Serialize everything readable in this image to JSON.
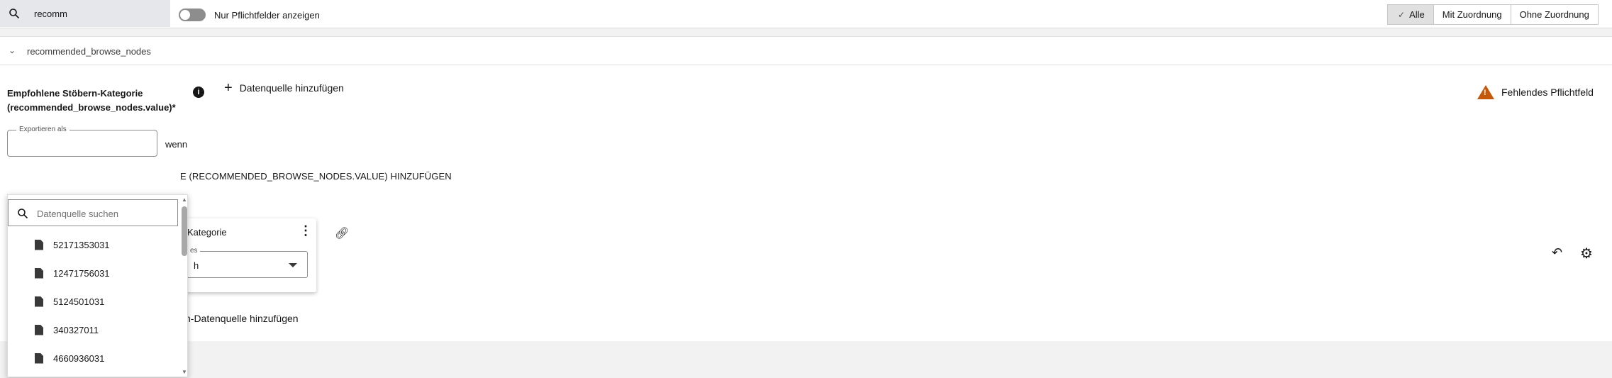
{
  "topbar": {
    "search_value": "recomm",
    "toggle_label": "Nur Pflichtfelder anzeigen",
    "filters": [
      "Alle",
      "Mit Zuordnung",
      "Ohne Zuordnung"
    ],
    "active_filter": "Alle"
  },
  "section": {
    "title": "recommended_browse_nodes"
  },
  "field": {
    "label": "Empfohlene Stöbern-Kategorie (recommended_browse_nodes.value)*",
    "add_source": "Datenquelle hinzufügen",
    "warning": "Fehlendes Pflichtfeld",
    "export_label": "Exportieren als",
    "wenn": "wenn",
    "rule_text": "E (RECOMMENDED_BROWSE_NODES.VALUE) HINZUFÜGEN",
    "card_title": "Kategorie",
    "card_select_label": "es",
    "card_select_value": "h",
    "bottom_add": "ch-Datenquelle hinzufügen"
  },
  "dropdown": {
    "search_placeholder": "Datenquelle suchen",
    "items": [
      "52171353031",
      "12471756031",
      "5124501031",
      "340327011",
      "4660936031"
    ]
  },
  "icons": {
    "search": "search-icon",
    "info": "info-icon",
    "warning": "warning-icon",
    "document": "document-icon",
    "link": "link-icon",
    "undo": "undo-icon",
    "settings": "gear-icon"
  },
  "colors": {
    "warning": "#c4580b",
    "active_filter_bg": "#e0e0e0"
  }
}
